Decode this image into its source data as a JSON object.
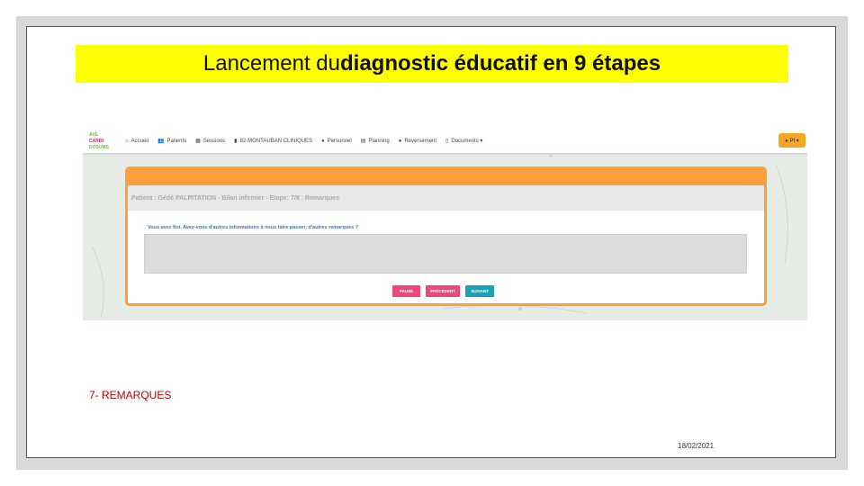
{
  "title": {
    "normal": "Lancement du ",
    "bold": "diagnostic éducatif en 9 étapes"
  },
  "screenshot": {
    "logo": {
      "line1": "AVE",
      "line2": "CARDI",
      "line3": "DOSUMS"
    },
    "nav": [
      {
        "icon": "home-icon",
        "glyph": "⌂",
        "label": "Accueil"
      },
      {
        "icon": "users-icon",
        "glyph": "👥",
        "label": "Patients"
      },
      {
        "icon": "calendar-icon",
        "glyph": "▦",
        "label": "Sessions"
      },
      {
        "icon": "building-icon",
        "glyph": "▮",
        "label": "82-MONTAUBAN CLINIQUES"
      },
      {
        "icon": "person-icon",
        "glyph": "●",
        "label": "Personnel"
      },
      {
        "icon": "planning-icon",
        "glyph": "▤",
        "label": "Planning"
      },
      {
        "icon": "person-icon",
        "glyph": "●",
        "label": "Reversement"
      },
      {
        "icon": "document-icon",
        "glyph": "▯",
        "label": "Documents ▾"
      }
    ],
    "user_menu": "● PI ▾",
    "patient_header": "Patient : Gédé PALPITATION - Bilan infirmier - Etape: 7/9 : Remarques",
    "question": "Vous avez fini. Avez-vous d'autres informations à nous faire passer, d'autres remarques ?",
    "textarea_value": "",
    "buttons": {
      "pause": "PAUSE",
      "previous": "PRÉCÉDENT",
      "next": "SUIVANT"
    },
    "colors": {
      "accent": "#ff9f3b",
      "pink": "#f0457a",
      "teal": "#17a2b8",
      "link": "#2e7cc7"
    }
  },
  "caption": "7- REMARQUES",
  "date": "18/02/2021"
}
